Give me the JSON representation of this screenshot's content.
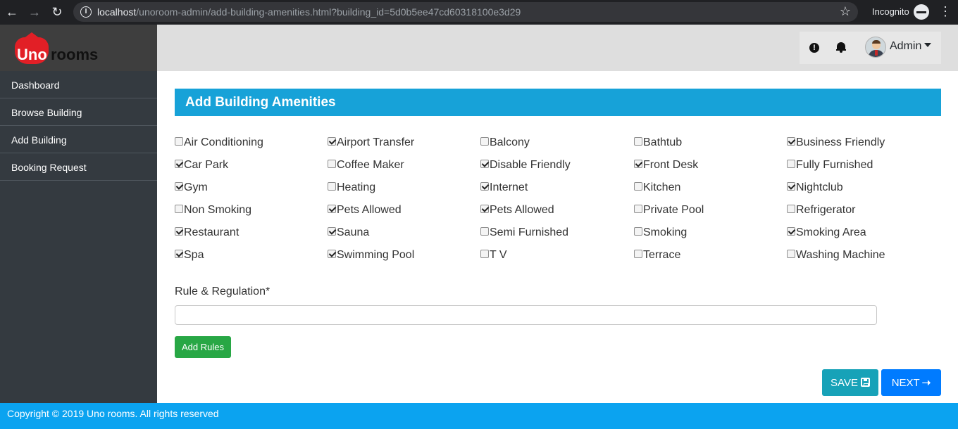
{
  "browser": {
    "url_host": "localhost",
    "url_path": "/unoroom-admin/add-building-amenities.html?building_id=5d0b5ee47cd60318100e3d29",
    "mode_label": "Incognito"
  },
  "brand": {
    "part1": "Uno",
    "part2": "rooms"
  },
  "sidebar": {
    "items": [
      {
        "label": "Dashboard"
      },
      {
        "label": "Browse Building"
      },
      {
        "label": "Add Building"
      },
      {
        "label": "Booking Request"
      }
    ]
  },
  "topbar": {
    "user_label": "Admin"
  },
  "panel": {
    "title": "Add Building Amenities"
  },
  "amenities": [
    {
      "label": "Air Conditioning",
      "checked": false
    },
    {
      "label": "Airport Transfer",
      "checked": true
    },
    {
      "label": "Balcony",
      "checked": false
    },
    {
      "label": "Bathtub",
      "checked": false
    },
    {
      "label": "Business Friendly",
      "checked": true
    },
    {
      "label": "Car Park",
      "checked": true
    },
    {
      "label": "Coffee Maker",
      "checked": false
    },
    {
      "label": "Disable Friendly",
      "checked": true
    },
    {
      "label": "Front Desk",
      "checked": true
    },
    {
      "label": "Fully Furnished",
      "checked": false
    },
    {
      "label": "Gym",
      "checked": true
    },
    {
      "label": "Heating",
      "checked": false
    },
    {
      "label": "Internet",
      "checked": true
    },
    {
      "label": "Kitchen",
      "checked": false
    },
    {
      "label": "Nightclub",
      "checked": true
    },
    {
      "label": "Non Smoking",
      "checked": false
    },
    {
      "label": "Pets Allowed",
      "checked": true
    },
    {
      "label": "Pets Allowed",
      "checked": true
    },
    {
      "label": "Private Pool",
      "checked": false
    },
    {
      "label": "Refrigerator",
      "checked": false
    },
    {
      "label": "Restaurant",
      "checked": true
    },
    {
      "label": "Sauna",
      "checked": true
    },
    {
      "label": "Semi Furnished",
      "checked": false
    },
    {
      "label": "Smoking",
      "checked": false
    },
    {
      "label": "Smoking Area",
      "checked": true
    },
    {
      "label": "Spa",
      "checked": true
    },
    {
      "label": "Swimming Pool",
      "checked": true
    },
    {
      "label": "T V",
      "checked": false
    },
    {
      "label": "Terrace",
      "checked": false
    },
    {
      "label": "Washing Machine",
      "checked": false
    }
  ],
  "rules": {
    "label": "Rule & Regulation*",
    "value": "",
    "add_button": "Add Rules"
  },
  "actions": {
    "save": "SAVE",
    "next": "NEXT"
  },
  "footer": {
    "text": "Copyright  © 2019 Uno rooms. All rights reserved"
  },
  "colors": {
    "panel_header": "#17a2d8",
    "sidebar": "#343a40",
    "footer": "#0ba3f0",
    "add_rules": "#28a745",
    "save": "#17a2b8",
    "next": "#007bff"
  }
}
